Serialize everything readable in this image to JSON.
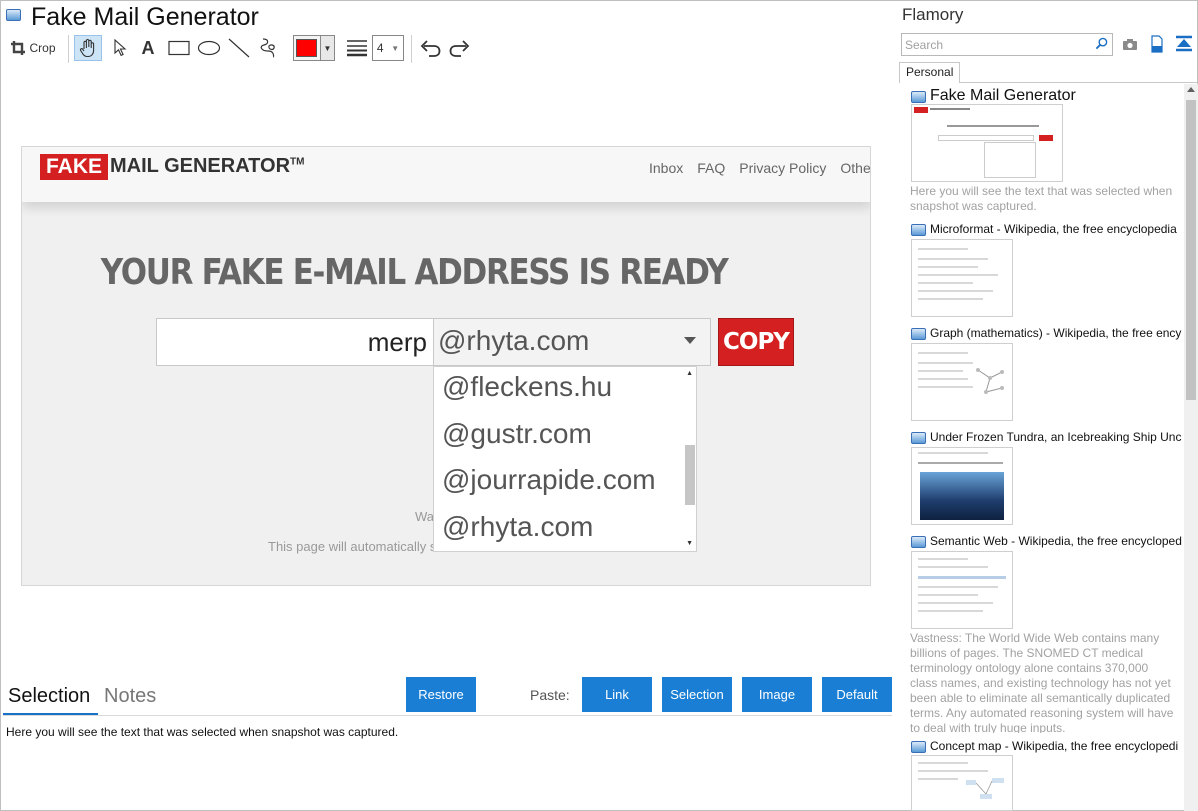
{
  "window": {
    "title": "Fake Mail Generator"
  },
  "toolbar": {
    "crop_label": "Crop",
    "line_width": "4",
    "accent_color": "#ff0000"
  },
  "snapshot": {
    "logo_fake": "FAKE",
    "logo_rest": "MAIL GENERATOR",
    "logo_tm": "TM",
    "nav": [
      "Inbox",
      "FAQ",
      "Privacy Policy",
      "Other F"
    ],
    "headline": "YOUR FAKE E-MAIL ADDRESS IS READY",
    "username": "merp",
    "domain": "@rhyta.com",
    "copy_label": "COPY",
    "dropdown_options": [
      "@fleckens.hu",
      "@gustr.com",
      "@jourrapide.com",
      "@rhyta.com"
    ],
    "faded_text_1": "Wa",
    "faded_text_2": "This page will automatically s"
  },
  "bottom": {
    "tab_selection": "Selection",
    "tab_notes": "Notes",
    "restore_label": "Restore",
    "paste_label": "Paste:",
    "paste_buttons": [
      "Link",
      "Selection",
      "Image",
      "Default"
    ],
    "selection_text": "Here you will see the text that was selected when snapshot was captured."
  },
  "sidebar": {
    "app_name": "Flamory",
    "search_placeholder": "Search",
    "tab_personal": "Personal",
    "entries": [
      {
        "title": "Fake Mail Generator",
        "description": "Here you will see the text that was selected when snapshot was captured."
      },
      {
        "title": "Microformat - Wikipedia, the free encyclopedia",
        "description": ""
      },
      {
        "title": "Graph (mathematics) - Wikipedia, the free ency",
        "description": ""
      },
      {
        "title": "Under Frozen Tundra, an Icebreaking Ship Unco",
        "description": ""
      },
      {
        "title": "Semantic Web - Wikipedia, the free encycloped",
        "description": "Vastness: The World Wide Web contains many billions of pages. The SNOMED CT medical terminology ontology alone contains 370,000 class names, and existing technology has not yet been able to eliminate all semantically duplicated terms. Any automated reasoning system will have to deal with truly huge inputs."
      },
      {
        "title": "Concept map - Wikipedia, the free encyclopedi",
        "description": ""
      }
    ]
  }
}
